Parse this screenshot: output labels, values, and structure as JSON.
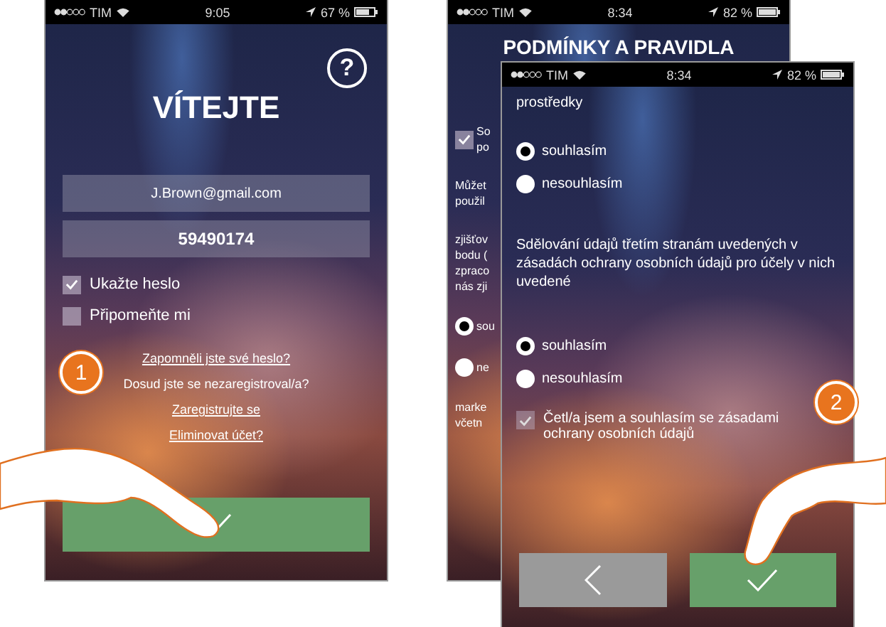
{
  "login_screen": {
    "status_bar": {
      "carrier": "TIM",
      "time": "9:05",
      "battery": "67 %"
    },
    "help": "?",
    "title": "VÍTEJTE",
    "fields": [
      {
        "value": "J.Brown@gmail.com",
        "kind": "plain"
      },
      {
        "value": "59490174",
        "kind": "bold"
      }
    ],
    "checkboxes": [
      {
        "label": "Ukažte heslo",
        "checked": true
      },
      {
        "label": "Připomeňte mi",
        "checked": false
      }
    ],
    "links": [
      {
        "kind": "link",
        "text": "Zapomněli jste své heslo?"
      },
      {
        "kind": "text",
        "text": "Dosud jste se nezaregistroval/a?"
      },
      {
        "kind": "link",
        "text": "Zaregistrujte se"
      },
      {
        "kind": "link",
        "text": "Eliminovat účet?"
      }
    ]
  },
  "back_screen": {
    "status_bar": {
      "carrier": "TIM",
      "time": "8:34",
      "battery": "82 %"
    },
    "title": "PODMÍNKY A PRAVIDLA",
    "fragments": [
      {
        "kind": "checkbox",
        "checked": true,
        "lines": [
          "So",
          "po"
        ]
      },
      {
        "kind": "text",
        "lines": [
          "Můžet",
          "použil"
        ]
      },
      {
        "kind": "text",
        "lines": [
          "zjišťov",
          "bodu (",
          "zpraco",
          "nás zji"
        ]
      },
      {
        "kind": "radio",
        "selected": true,
        "lines": [
          "sou"
        ]
      },
      {
        "kind": "radio",
        "selected": false,
        "lines": [
          "ne"
        ]
      },
      {
        "kind": "text",
        "lines": [
          "marke",
          "včetn"
        ]
      }
    ]
  },
  "front_screen": {
    "status_bar": {
      "carrier": "TIM",
      "time": "8:34",
      "battery": "82 %"
    },
    "cut_text": "prostředky",
    "groups": [
      {
        "radios": [
          {
            "label": "souhlasím",
            "selected": true
          },
          {
            "label": "nesouhlasím",
            "selected": false
          }
        ]
      },
      {
        "text": "Sdělování údajů třetím stranám uvedených v zásadách ochrany osobních údajů pro účely v nich uvedené",
        "radios": [
          {
            "label": "souhlasím",
            "selected": true
          },
          {
            "label": "nesouhlasím",
            "selected": false
          }
        ]
      }
    ],
    "consent": {
      "label": "Četl/a jsem a souhlasím se zásadami ochrany osobních údajů",
      "checked": true
    }
  },
  "steps": [
    "1",
    "2"
  ]
}
